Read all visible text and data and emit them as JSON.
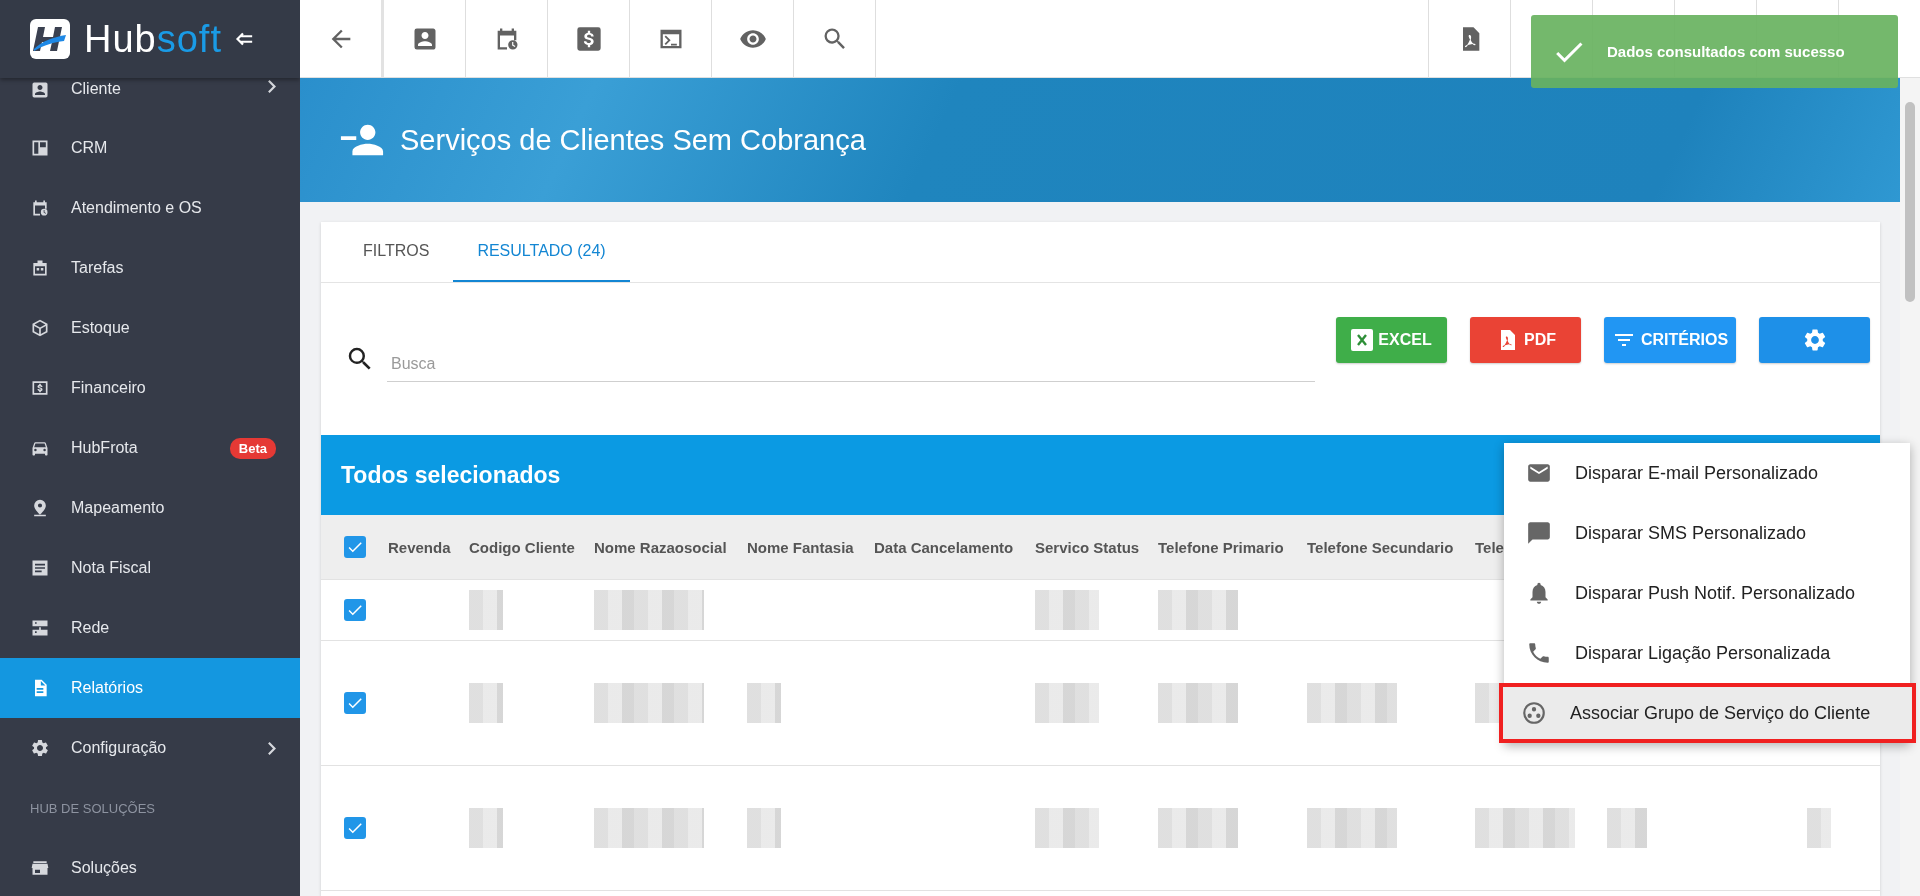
{
  "sidebar": {
    "logo": {
      "main": "Hub",
      "accent": "soft"
    },
    "items": [
      {
        "kind": "item",
        "label": "Cliente",
        "selected": false,
        "expandable": true
      },
      {
        "kind": "item",
        "label": "CRM",
        "selected": false
      },
      {
        "kind": "item",
        "label": "Atendimento e OS",
        "selected": false
      },
      {
        "kind": "item",
        "label": "Tarefas",
        "selected": false
      },
      {
        "kind": "item",
        "label": "Estoque",
        "selected": false
      },
      {
        "kind": "item",
        "label": "Financeiro",
        "selected": false
      },
      {
        "kind": "item",
        "label": "HubFrota",
        "selected": false,
        "badge": "Beta"
      },
      {
        "kind": "item",
        "label": "Mapeamento",
        "selected": false
      },
      {
        "kind": "item",
        "label": "Nota Fiscal",
        "selected": false
      },
      {
        "kind": "item",
        "label": "Rede",
        "selected": false
      },
      {
        "kind": "item",
        "label": "Relatórios",
        "selected": true
      },
      {
        "kind": "item",
        "label": "Configuração",
        "selected": false,
        "expandable": true
      },
      {
        "kind": "section",
        "label": "HUB DE SOLUÇÕES"
      },
      {
        "kind": "item",
        "label": "Soluções",
        "selected": false
      }
    ]
  },
  "page": {
    "title": "Serviços de Clientes Sem Cobrança"
  },
  "tabs": [
    {
      "label": "FILTROS",
      "selected": false
    },
    {
      "label": "RESULTADO (24)",
      "selected": true
    }
  ],
  "search": {
    "placeholder": "Busca"
  },
  "actions": [
    {
      "kind": "excel",
      "label": "EXCEL"
    },
    {
      "kind": "pdf",
      "label": "PDF"
    },
    {
      "kind": "criteria",
      "label": "CRITÉRIOS"
    },
    {
      "kind": "settings"
    }
  ],
  "selection_bar": {
    "title": "Todos selecionados"
  },
  "table": {
    "all_selected": true,
    "columns": [
      {
        "label": "Revenda"
      },
      {
        "label": "Codigo Cliente"
      },
      {
        "label": "Nome Razaosocial"
      },
      {
        "label": "Nome Fantasia"
      },
      {
        "label": "Data Cancelamento"
      },
      {
        "label": "Servico Status"
      },
      {
        "label": "Telefone Primario"
      },
      {
        "label": "Telefone Secundario"
      },
      {
        "label": "Tele"
      },
      {},
      {}
    ],
    "rows": [
      {
        "selected": true,
        "cells": [
          {
            "kind": "empty"
          },
          {
            "kind": "blurred"
          },
          {
            "kind": "blurred"
          },
          {
            "kind": "empty"
          },
          {
            "kind": "empty"
          },
          {
            "kind": "blurred"
          },
          {
            "kind": "blurred"
          },
          {
            "kind": "empty"
          },
          {
            "kind": "empty"
          },
          {
            "kind": "empty"
          },
          {
            "kind": "empty"
          }
        ]
      },
      {
        "selected": true,
        "cells": [
          {
            "kind": "empty"
          },
          {
            "kind": "blurred"
          },
          {
            "kind": "blurred"
          },
          {
            "kind": "blurred"
          },
          {
            "kind": "empty"
          },
          {
            "kind": "blurred"
          },
          {
            "kind": "blurred"
          },
          {
            "kind": "blurred"
          },
          {
            "kind": "blurred"
          },
          {
            "kind": "empty"
          },
          {
            "kind": "empty"
          }
        ]
      },
      {
        "selected": true,
        "cells": [
          {
            "kind": "empty"
          },
          {
            "kind": "blurred"
          },
          {
            "kind": "blurred"
          },
          {
            "kind": "blurred"
          },
          {
            "kind": "empty"
          },
          {
            "kind": "blurred"
          },
          {
            "kind": "blurred"
          },
          {
            "kind": "blurred"
          },
          {
            "kind": "blurred"
          },
          {
            "kind": "blurred"
          },
          {
            "kind": "blurred"
          }
        ]
      }
    ]
  },
  "context_menu": {
    "items": [
      {
        "label": "Disparar E-mail Personalizado",
        "selected": false
      },
      {
        "label": "Disparar SMS Personalizado",
        "selected": false
      },
      {
        "label": "Disparar Push Notif. Personalizado",
        "selected": false
      },
      {
        "label": "Disparar Ligação Personalizada",
        "selected": false
      },
      {
        "label": "Associar Grupo de Serviço do Cliente",
        "selected": true
      }
    ]
  },
  "toast": {
    "message": "Dados consultados com sucesso"
  }
}
